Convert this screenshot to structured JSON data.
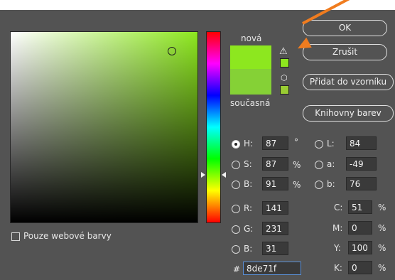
{
  "buttons": {
    "ok": "OK",
    "cancel": "Zrušit",
    "add_to_swatches": "Přidat do vzorníku",
    "color_libraries": "Knihovny barev"
  },
  "swatch_labels": {
    "new": "nová",
    "current": "současná"
  },
  "colors": {
    "new": "#8de71f",
    "current": "#85d136",
    "gamut_warning_swatch": "#8de71f",
    "web_safe_swatch": "#99cc33",
    "arrow": "#f07c1f"
  },
  "only_web_colors_label": "Pouze webové barvy",
  "hsb": {
    "h": {
      "label": "H:",
      "value": "87",
      "unit": "°"
    },
    "s": {
      "label": "S:",
      "value": "87",
      "unit": "%"
    },
    "b": {
      "label": "B:",
      "value": "91",
      "unit": "%"
    }
  },
  "rgb": {
    "r": {
      "label": "R:",
      "value": "141"
    },
    "g": {
      "label": "G:",
      "value": "231"
    },
    "b": {
      "label": "B:",
      "value": "31"
    }
  },
  "lab": {
    "l": {
      "label": "L:",
      "value": "84"
    },
    "a": {
      "label": "a:",
      "value": "-49"
    },
    "b": {
      "label": "b:",
      "value": "76"
    }
  },
  "cmyk": {
    "c": {
      "label": "C:",
      "value": "51",
      "unit": "%"
    },
    "m": {
      "label": "M:",
      "value": "0",
      "unit": "%"
    },
    "y": {
      "label": "Y:",
      "value": "100",
      "unit": "%"
    },
    "k": {
      "label": "K:",
      "value": "0",
      "unit": "%"
    }
  },
  "hex": {
    "label": "#",
    "value": "8de71f"
  },
  "selected_mode": "H",
  "icons": [
    "gamut-warning-icon",
    "web-safe-cube-icon"
  ]
}
